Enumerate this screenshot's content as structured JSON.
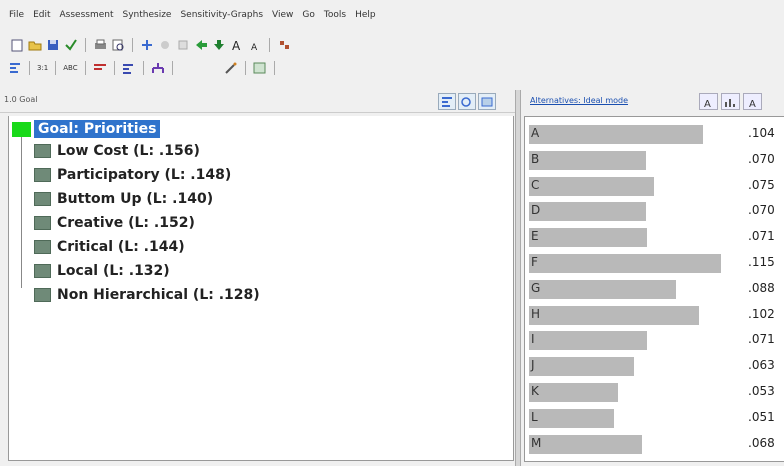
{
  "menu": [
    "File",
    "Edit",
    "Assessment",
    "Synthesize",
    "Sensitivity-Graphs",
    "View",
    "Go",
    "Tools",
    "Help"
  ],
  "toolbar2": {
    "label_a": "3:1",
    "label_b": "ABC"
  },
  "goal_header": {
    "caption": "1.0 Goal"
  },
  "alternatives_header": {
    "caption": "Alternatives: Ideal mode"
  },
  "goal": {
    "label": "Goal: Priorities",
    "color": "#19d919",
    "highlight": "#2f73cc"
  },
  "criteria": [
    {
      "label": "Low Cost (L: .156)"
    },
    {
      "label": "Participatory (L: .148)"
    },
    {
      "label": "Buttom Up (L: .140)"
    },
    {
      "label": "Creative (L: .152)"
    },
    {
      "label": "Critical (L: .144)"
    },
    {
      "label": "Local (L: .132)"
    },
    {
      "label": "Non Hierarchical (L: .128)"
    }
  ],
  "alternatives": [
    {
      "name": "A",
      "value": ".104",
      "ratio": 0.904
    },
    {
      "name": "B",
      "value": ".070",
      "ratio": 0.609
    },
    {
      "name": "C",
      "value": ".075",
      "ratio": 0.652
    },
    {
      "name": "D",
      "value": ".070",
      "ratio": 0.609
    },
    {
      "name": "E",
      "value": ".071",
      "ratio": 0.617
    },
    {
      "name": "F",
      "value": ".115",
      "ratio": 1.0
    },
    {
      "name": "G",
      "value": ".088",
      "ratio": 0.765
    },
    {
      "name": "H",
      "value": ".102",
      "ratio": 0.887
    },
    {
      "name": "I",
      "value": ".071",
      "ratio": 0.617
    },
    {
      "name": "J",
      "value": ".063",
      "ratio": 0.548
    },
    {
      "name": "K",
      "value": ".053",
      "ratio": 0.461
    },
    {
      "name": "L",
      "value": ".051",
      "ratio": 0.443
    },
    {
      "name": "M",
      "value": ".068",
      "ratio": 0.591
    }
  ]
}
